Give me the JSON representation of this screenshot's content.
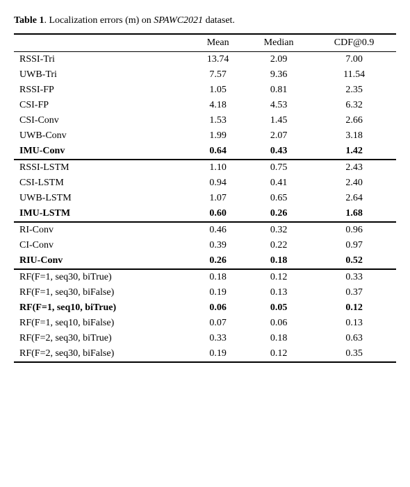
{
  "title": {
    "prefix": "Table 1",
    "text": ". Localization errors (m) on ",
    "italic": "SPAWC2021",
    "suffix": " dataset."
  },
  "columns": [
    "",
    "Mean",
    "Median",
    "CDF@0.9"
  ],
  "groups": [
    {
      "rows": [
        {
          "name": "RSSI-Tri",
          "mean": "13.74",
          "median": "2.09",
          "cdf": "7.00",
          "bold": false
        },
        {
          "name": "UWB-Tri",
          "mean": "7.57",
          "median": "9.36",
          "cdf": "11.54",
          "bold": false
        },
        {
          "name": "RSSI-FP",
          "mean": "1.05",
          "median": "0.81",
          "cdf": "2.35",
          "bold": false
        },
        {
          "name": "CSI-FP",
          "mean": "4.18",
          "median": "4.53",
          "cdf": "6.32",
          "bold": false
        },
        {
          "name": "CSI-Conv",
          "mean": "1.53",
          "median": "1.45",
          "cdf": "2.66",
          "bold": false
        },
        {
          "name": "UWB-Conv",
          "mean": "1.99",
          "median": "2.07",
          "cdf": "3.18",
          "bold": false
        },
        {
          "name": "IMU-Conv",
          "mean": "0.64",
          "median": "0.43",
          "cdf": "1.42",
          "bold": true
        }
      ]
    },
    {
      "rows": [
        {
          "name": "RSSI-LSTM",
          "mean": "1.10",
          "median": "0.75",
          "cdf": "2.43",
          "bold": false
        },
        {
          "name": "CSI-LSTM",
          "mean": "0.94",
          "median": "0.41",
          "cdf": "2.40",
          "bold": false
        },
        {
          "name": "UWB-LSTM",
          "mean": "1.07",
          "median": "0.65",
          "cdf": "2.64",
          "bold": false
        },
        {
          "name": "IMU-LSTM",
          "mean": "0.60",
          "median": "0.26",
          "cdf": "1.68",
          "bold": true
        }
      ]
    },
    {
      "rows": [
        {
          "name": "RI-Conv",
          "mean": "0.46",
          "median": "0.32",
          "cdf": "0.96",
          "bold": false
        },
        {
          "name": "CI-Conv",
          "mean": "0.39",
          "median": "0.22",
          "cdf": "0.97",
          "bold": false
        },
        {
          "name": "RIU-Conv",
          "mean": "0.26",
          "median": "0.18",
          "cdf": "0.52",
          "bold": true
        }
      ]
    },
    {
      "rows": [
        {
          "name": "RF(F=1, seq30, biTrue)",
          "mean": "0.18",
          "median": "0.12",
          "cdf": "0.33",
          "bold": false
        },
        {
          "name": "RF(F=1, seq30, biFalse)",
          "mean": "0.19",
          "median": "0.13",
          "cdf": "0.37",
          "bold": false
        },
        {
          "name": "RF(F=1, seq10, biTrue)",
          "mean": "0.06",
          "median": "0.05",
          "cdf": "0.12",
          "bold": true
        },
        {
          "name": "RF(F=1, seq10, biFalse)",
          "mean": "0.07",
          "median": "0.06",
          "cdf": "0.13",
          "bold": false
        },
        {
          "name": "RF(F=2, seq30, biTrue)",
          "mean": "0.33",
          "median": "0.18",
          "cdf": "0.63",
          "bold": false
        },
        {
          "name": "RF(F=2, seq30, biFalse)",
          "mean": "0.19",
          "median": "0.12",
          "cdf": "0.35",
          "bold": false
        }
      ]
    }
  ]
}
